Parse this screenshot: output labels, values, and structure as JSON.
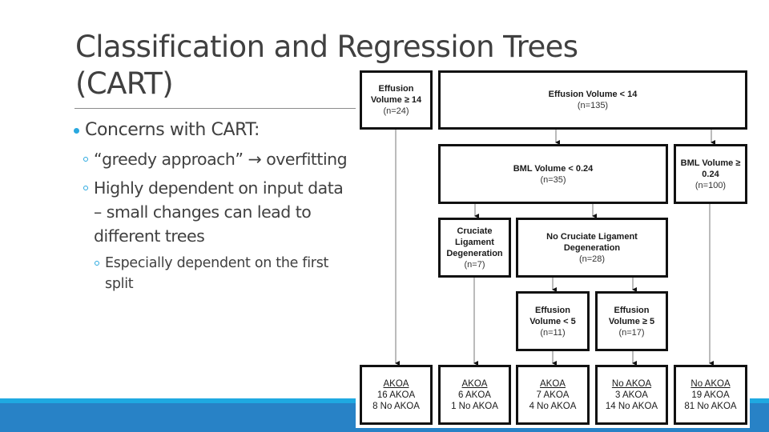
{
  "slide": {
    "title": "Classification and Regression Trees (CART)",
    "bullets": [
      {
        "level": 1,
        "text": "Concerns with CART:"
      },
      {
        "level": 2,
        "text": "“greedy approach” → overfitting"
      },
      {
        "level": 2,
        "text": "Highly dependent on input data – small changes can lead to different trees"
      },
      {
        "level": 3,
        "text": "Especially dependent on the first split"
      }
    ]
  },
  "colors": {
    "accent": "#29a8df",
    "footer_light": "#1fa9e1",
    "footer_dark": "#2882c6",
    "text": "#404040"
  },
  "tree": {
    "nodes": {
      "root_ge14": {
        "label": "Effusion Volume ≥ 14",
        "n": "(n=24)"
      },
      "root_lt14": {
        "label": "Effusion Volume < 14",
        "n": "(n=135)"
      },
      "bml_lt": {
        "label": "BML Volume < 0.24",
        "n": "(n=35)"
      },
      "bml_ge": {
        "label": "BML Volume ≥ 0.24",
        "n": "(n=100)"
      },
      "cruciate": {
        "label": "Cruciate Ligament Degeneration",
        "n": "(n=7)"
      },
      "no_cruciate": {
        "label": "No Cruciate Ligament Degeneration",
        "n": "(n=28)"
      },
      "eff_lt5": {
        "label": "Effusion Volume < 5",
        "n": "(n=11)"
      },
      "eff_ge5": {
        "label": "Effusion Volume ≥ 5",
        "n": "(n=17)"
      }
    },
    "leaves": [
      {
        "class": "AKOA",
        "akoa": "16 AKOA",
        "no_akoa": "8 No AKOA"
      },
      {
        "class": "AKOA",
        "akoa": "6 AKOA",
        "no_akoa": "1 No AKOA"
      },
      {
        "class": "AKOA",
        "akoa": "7 AKOA",
        "no_akoa": "4 No AKOA"
      },
      {
        "class": "No AKOA",
        "akoa": "3 AKOA",
        "no_akoa": "14 No AKOA"
      },
      {
        "class": "No AKOA",
        "akoa": "19 AKOA",
        "no_akoa": "81 No AKOA"
      }
    ]
  }
}
